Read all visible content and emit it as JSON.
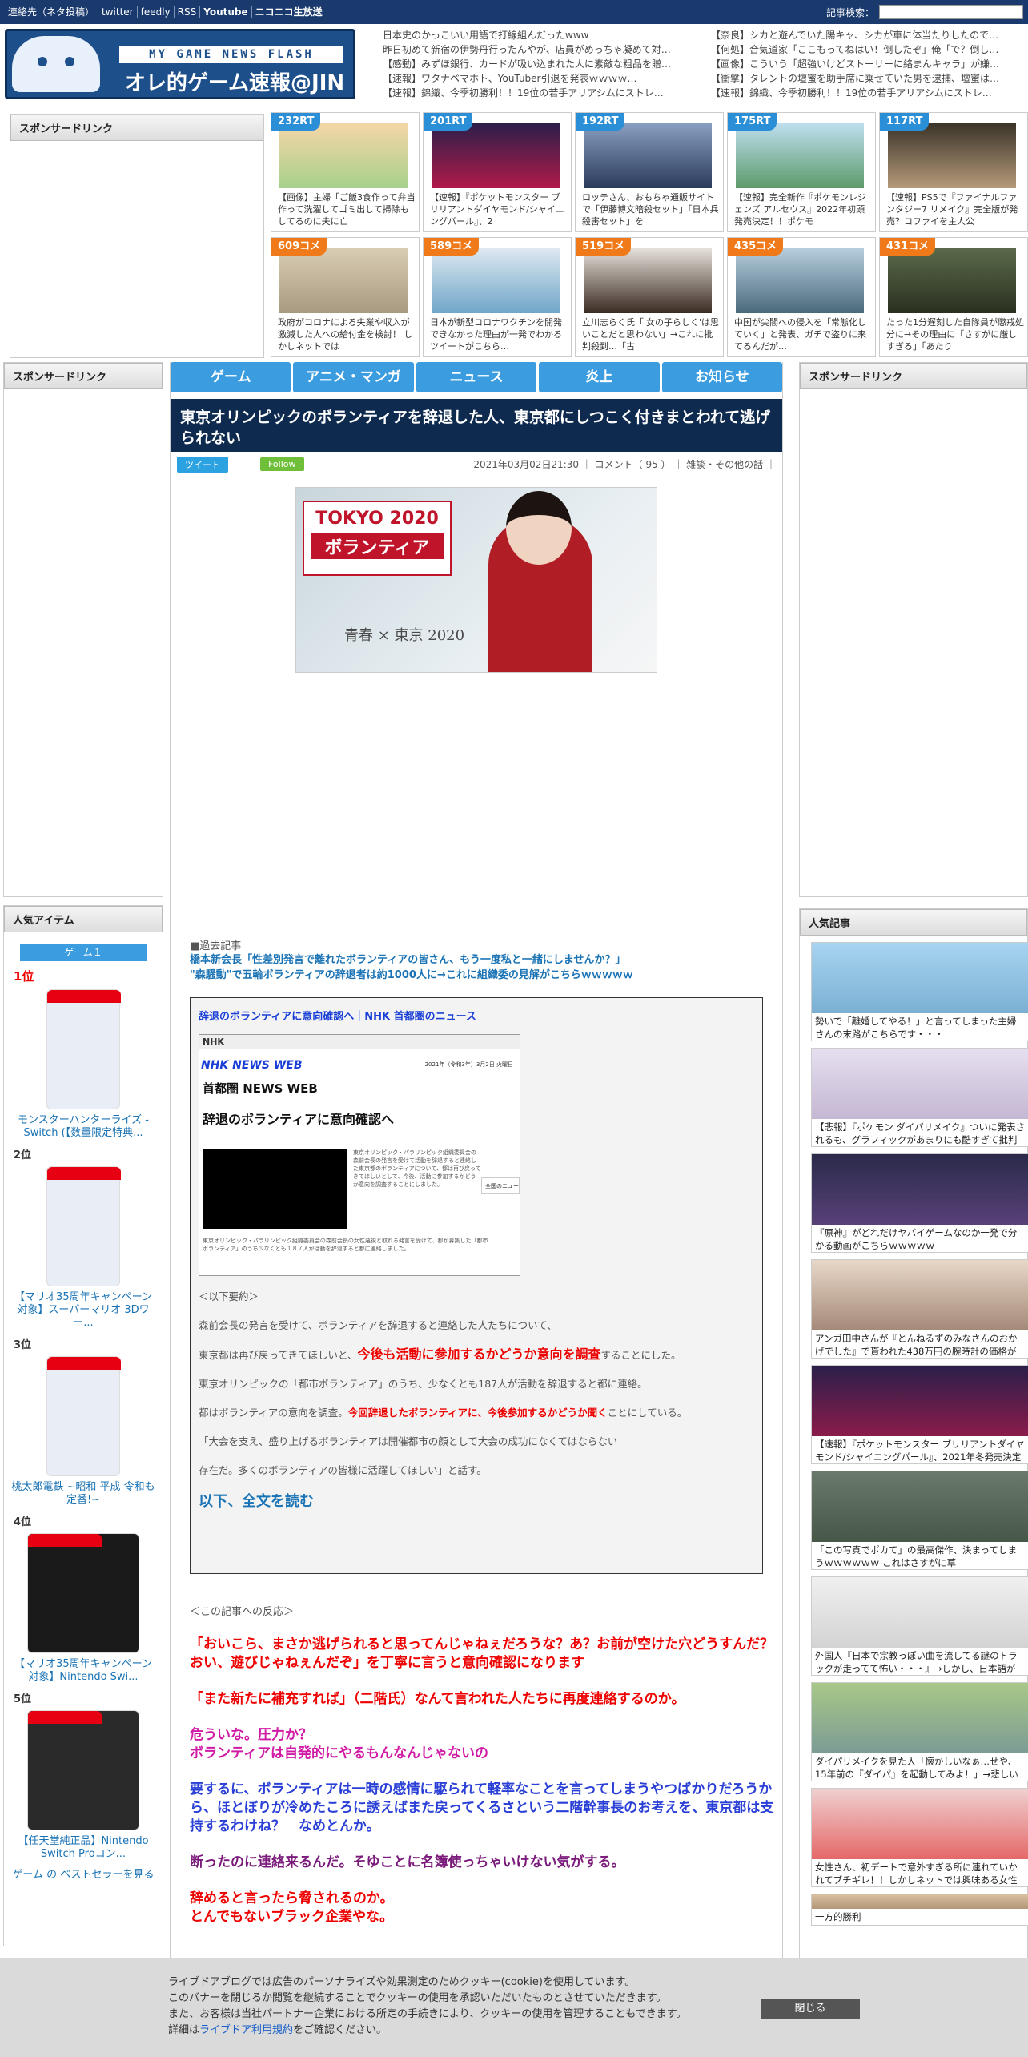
{
  "topbar": {
    "links": [
      "連絡先（ネタ投稿）",
      "twitter",
      "feedly",
      "RSS",
      "Youtube",
      "ニコニコ生放送"
    ],
    "search_label": "記事検索："
  },
  "logo": {
    "sub": "MY GAME NEWS FLASH",
    "main": "オレ的ゲーム速報@JIN"
  },
  "header_news": {
    "left": [
      "日本史のかっこいい用語で打線組んだったwww",
      "昨日初めて新宿の伊勢丹行ったんやが、店員がめっちゃ凝めて対…",
      "【感動】みずほ銀行、カードが吸い込まれた人に素敵な粗品を贈…",
      "【速報】ワタナベマホト、YouTuber引退を発表ｗｗｗｗ…",
      "【速報】錦織、今季初勝利！！19位の若手アリアシムにストレ…"
    ],
    "right": [
      "【奈良】シカと遊んでいた陽キャ、シカが車に体当たりしたので…",
      "【何処】合気道家「ここもってねはい！倒したぞ」俺「で？倒し…",
      "【画像】こういう「超強いけどストーリーに絡まんキャラ」が嫌…",
      "【衝撃】タレントの壇蜜を助手席に乗せていた男を逮捕、壇蜜は…",
      "【速報】錦織、今季初勝利！！19位の若手アリアシムにストレ…"
    ]
  },
  "sponsor": "スポンサードリンク",
  "cards": [
    {
      "badge": "232RT",
      "text": "【画像】主婦「ご飯3食作って弁当作って洗濯してゴミ出して掃除もしてるのに夫に亡"
    },
    {
      "badge": "201RT",
      "text": "【速報】『ポケットモンスター ブリリアントダイヤモンド/シャイニングパール』、2"
    },
    {
      "badge": "192RT",
      "text": "ロッテさん、おもちゃ通販サイトで「伊藤博文暗殺セット」「日本兵殺害セット」を"
    },
    {
      "badge": "175RT",
      "text": "【速報】完全新作『ポケモンレジェンズ アルセウス』2022年初頭発売決定！！ポケモ"
    },
    {
      "badge": "117RT",
      "text": "【速報】PS5で『ファイナルファンタジー7 リメイク』完全版が発売？コファイを主人公"
    },
    {
      "badge": "609コメ",
      "text": "政府がコロナによる失業や収入が激減した人への給付金を検討！ しかしネットでは"
    },
    {
      "badge": "589コメ",
      "text": "日本が新型コロナワクチンを開発できなかった理由が一発でわかるツイートがこちら…"
    },
    {
      "badge": "519コメ",
      "text": "立川志らく氏「'女の子らしく'は思いことだと思わない」→これに批判殺到…「古"
    },
    {
      "badge": "435コメ",
      "text": "中国が尖閣への侵入を「常態化していく」と発表、ガチで盗りに来てるんだが…"
    },
    {
      "badge": "431コメ",
      "text": "たった1分遅刻した自隊員が懲戒処分に→その理由に「さすがに厳しすぎる」「あたり"
    }
  ],
  "nav": [
    "ゲーム",
    "アニメ・マンガ",
    "ニュース",
    "炎上",
    "お知らせ"
  ],
  "article": {
    "title": "東京オリンピックのボランティアを辞退した人、東京都にしつこく付きまとわれて逃げられない",
    "tweet": "ツイート",
    "follow": "Follow",
    "meta": "2021年03月02日21:30 ｜ コメント（ 95 ） ｜ 雑談・その他の話 ｜",
    "hero_l1": "TOKYO 2020",
    "hero_l2": "ボランティア",
    "hero_sig": "青春 × 東京 2020",
    "past_label": "■過去記事",
    "past_links": [
      "橋本新会長「性差別発言で離れたボランティアの皆さん、もう一度私と一緒にしませんか？」",
      "\"森騒動\"で五輪ボランティアの辞退者は約1000人に→これに組織委の見解がこちらｗｗｗｗｗ"
    ],
    "quote_title": "辞退のボランティアに意向確認へ｜NHK 首都圏のニュース",
    "shot": {
      "bar": "NHK",
      "nhk": "NHK NEWS WEB",
      "date": "2021年（令和3年）3月2日 火曜日",
      "sec": "首都圏 NEWS WEB",
      "h": "辞退のボランティアに意向確認へ",
      "sm": "東京オリンピック・パラリンピック組織委員会の森前会長の発言を受けて活動を辞退すると連絡した東京都のボランティアについて、都は再び戻ってきてほしいとして、今後、活動に参加するかどうか意向を調査することにしました。",
      "sm2": "東京オリンピック・パラリンピック組織委員会の森前会長の女性蔑視と取れる発言を受けて、都が募集した「都市ボランティア」のうち少なくとも１８７人が活動を辞退すると都に連絡しました。",
      "btn": "全国のニュー"
    },
    "p_summary": "＜以下要約＞",
    "p1": "森前会長の発言を受けて、ボランティアを辞退すると連絡した人たちについて、",
    "p2a": "東京都は再び戻ってきてほしいと、",
    "p2b": "今後も活動に参加するかどうか意向を調査",
    "p2c": "することにした。",
    "p3": "東京オリンピックの「都市ボランティア」のうち、少なくとも187人が活動を辞退すると都に連絡。",
    "p4a": "都はボランティアの意向を調査。",
    "p4b": "今回辞退したボランティアに、今後参加するかどうか聞く",
    "p4c": "ことにしている。",
    "p5": "「大会を支え、盛り上げるボランティアは開催都市の顔として大会の成功になくてはならない",
    "p6": "存在だ。多くのボランティアの皆様に活躍してほしい」と話す。",
    "readmore": "以下、全文を読む",
    "reacts_head": "＜この記事への反応＞",
    "reactions": [
      {
        "c": "r",
        "t": "「おいこら、まさか逃げられると思ってんじゃねぇだろうな？あ？お前が空けた穴どうすんだ？おい、遊びじゃねぇんだぞ」を丁寧に言うと意向確認になります"
      },
      {
        "c": "r",
        "t": "「また新たに補充すれば」（二階氏）なんて言われた人たちに再度連絡するのか。"
      },
      {
        "c": "m",
        "t": "危ういな。圧力か？\nボランティアは自発的にやるもんなんじゃないの"
      },
      {
        "c": "b",
        "t": "要するに、ボランティアは一時の感情に駆られて軽率なことを言ってしまうやつばかりだろうから、ほとぼりが冷めたころに誘えばまた戻ってくるさという二階幹事長のお考えを、東京都は支持するわけね？　なめとんか。"
      },
      {
        "c": "p",
        "t": "断ったのに連絡来るんだ。そゆことに名簿使っちゃいけない気がする。"
      },
      {
        "c": "r",
        "t": "辞めると言ったら脅されるのか。\nとんでもないブラック企業やな。"
      }
    ]
  },
  "left": {
    "popular": "人気アイテム",
    "tab": "ゲーム１",
    "items": [
      {
        "rank": "1位",
        "cap": "モンスターハンターライズ -Switch (【数量限定特典..."
      },
      {
        "rank": "2位",
        "cap": "【マリオ35周年キャンペーン対象】スーパーマリオ 3Dワー..."
      },
      {
        "rank": "3位",
        "cap": "桃太郎電鉄 ~昭和 平成 令和も定番!~"
      },
      {
        "rank": "4位",
        "cap": "【マリオ35周年キャンペーン対象】Nintendo Swi..."
      },
      {
        "rank": "5位",
        "cap": "【任天堂純正品】Nintendo Switch Proコン..."
      }
    ],
    "best": "ゲーム の ベストセラーを見る"
  },
  "right": {
    "popular": "人気記事",
    "items": [
      "勢いで「離婚してやる！」と言ってしまった主婦さんの末路がこちらです・・・",
      "【悲報】『ポケモン ダイパリメイク』ついに発表されるも、グラフィックがあまりにも酷すぎて批判殺",
      "『原神』がどれだけヤバイゲームなのか一発で分かる動画がこちらｗｗｗｗｗ",
      "アンガ田中さんが『とんねるずのみなさんのおかげでした』で貰われた438万円の腕時計の価格が判明",
      "【速報】『ポケットモンスター ブリリアントダイヤモンド/シャイニングパール』、2021年冬発売決定",
      "「この写真でポカて」の最高傑作、決まってしまうｗｗｗｗｗｗ これはさすがに草",
      "外国人『日本で宗教っぽい曲を流してる謎のトラックが走ってて怖い・・・』→しかし、日本語がわかる",
      "ダイパリメイクを見た人「懐かしいなぁ…せや、15年前の『ダイパ』を起動してみよ！」→悲しい",
      "女性さん、初デートで意外すぎる所に連れていかれてブチギレ！！しかしネットでは興味ある女性が",
      "一方的勝利"
    ]
  },
  "cookie": {
    "l1": "ライブドアブログでは広告のパーソナライズや効果測定のためクッキー(cookie)を使用しています。",
    "l2": "このバナーを閉じるか閲覧を継続することでクッキーの使用を承認いただいたものとさせていただきます。",
    "l3": "また、お客様は当社パートナー企業における所定の手続きにより、クッキーの使用を管理することもできます。",
    "l4a": "詳細は",
    "l4link": "ライブドア利用規約",
    "l4b": "をご確認ください。",
    "close": "閉じる"
  },
  "colors": {
    "topbar": "#1a3a6e",
    "nav": "#3b9de0",
    "title_bg": "#0e2a4e",
    "rt_badge": "#2a8fd6",
    "comment_badge": "#f07a1a",
    "red": "#e00"
  }
}
